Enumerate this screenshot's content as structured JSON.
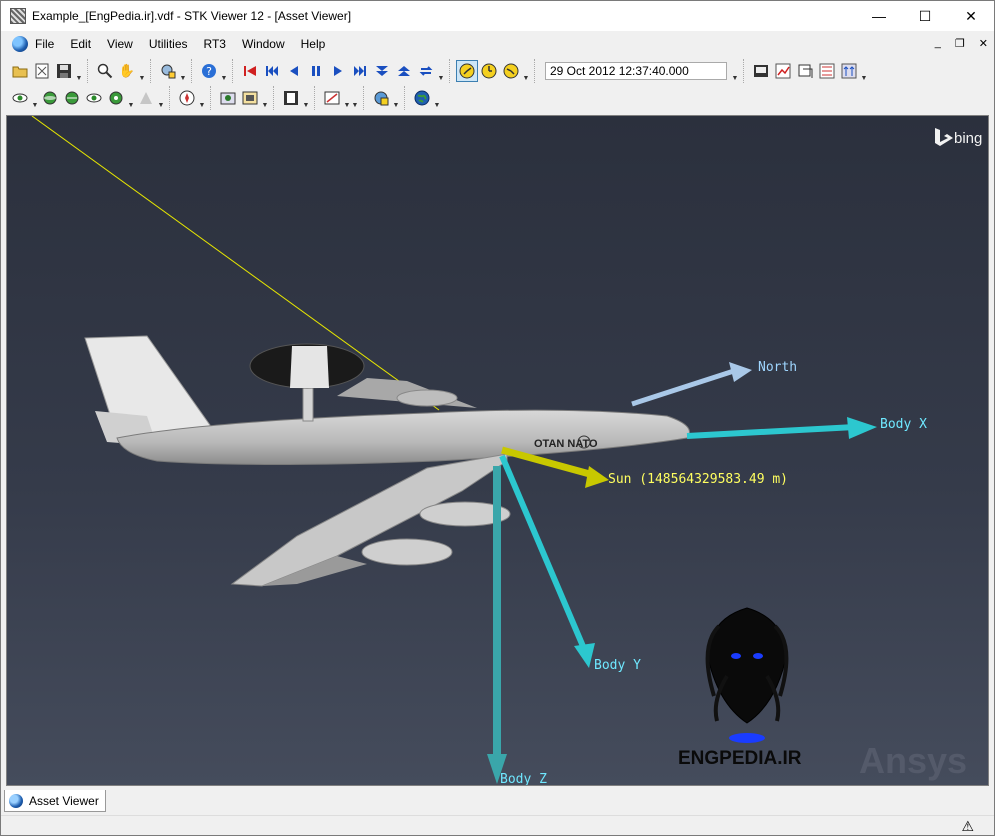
{
  "window": {
    "title": "Example_[EngPedia.ir].vdf - STK Viewer 12 - [Asset Viewer]"
  },
  "window_controls": {
    "minimize": "—",
    "maximize": "☐",
    "close": "✕"
  },
  "menu": {
    "items": [
      "File",
      "Edit",
      "View",
      "Utilities",
      "RT3",
      "Window",
      "Help"
    ]
  },
  "mdi_controls": {
    "minimize": "_",
    "restore": "❐",
    "close": "✕"
  },
  "toolbar": {
    "current_time": "29 Oct 2012 12:37:40.000"
  },
  "viewport": {
    "map_provider": "bing",
    "vectors": {
      "north": "North",
      "body_x": "Body X",
      "body_y": "Body Y",
      "body_z": "Body Z",
      "sun": "Sun (148564329583.49 m)"
    },
    "aircraft_markings": {
      "fuselage_text": "OTAN NATO"
    },
    "watermarks": {
      "engpedia": "ENGPEDIA.IR",
      "ansys": "Ansys"
    }
  },
  "tabs": [
    {
      "label": "Asset Viewer"
    }
  ],
  "status": {
    "warning_icon": "warning-icon"
  },
  "colors": {
    "vector_cyan": "#2cc7cf",
    "vector_north": "#a9c8e8",
    "sun_vector": "#c8c800",
    "sun_label": "#ffff60",
    "label_cyan": "#6fe8ff"
  }
}
